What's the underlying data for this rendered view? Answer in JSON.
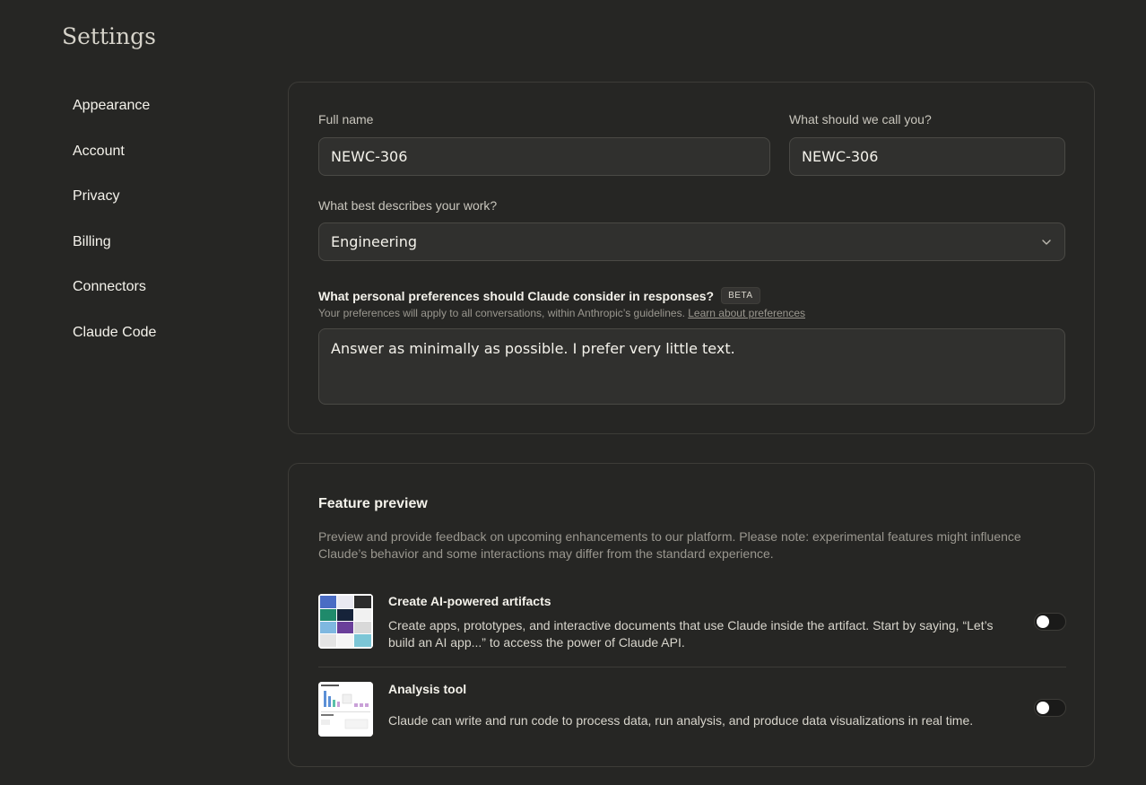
{
  "page": {
    "title": "Settings"
  },
  "sidebar": {
    "items": [
      {
        "label": "Appearance"
      },
      {
        "label": "Account"
      },
      {
        "label": "Privacy"
      },
      {
        "label": "Billing"
      },
      {
        "label": "Connectors"
      },
      {
        "label": "Claude Code"
      }
    ]
  },
  "profile": {
    "full_name_label": "Full name",
    "full_name_value": "NEWC-306",
    "nickname_label": "What should we call you?",
    "nickname_value": "NEWC-306",
    "work_label": "What best describes your work?",
    "work_value": "Engineering",
    "preferences_label": "What personal preferences should Claude consider in responses?",
    "beta_badge": "BETA",
    "preferences_hint": "Your preferences will apply to all conversations, within Anthropic’s guidelines.",
    "preferences_link": "Learn about preferences",
    "preferences_value": "Answer as minimally as possible. I prefer very little text."
  },
  "feature_preview": {
    "title": "Feature preview",
    "description": "Preview and provide feedback on upcoming enhancements to our platform. Please note: experimental features might influence Claude’s behavior and some interactions may differ from the standard experience.",
    "features": [
      {
        "title": "Create AI-powered artifacts",
        "description": "Create apps, prototypes, and interactive documents that use Claude inside the artifact. Start by saying, “Let’s build an AI app...” to access the power of Claude API.",
        "enabled": false
      },
      {
        "title": "Analysis tool",
        "description": "Claude can write and run code to process data, run analysis, and produce data visualizations in real time.",
        "enabled": false
      }
    ]
  },
  "colors": {
    "background": "#262624",
    "card_border": "#3d3c38",
    "input_bg": "#30302e",
    "text_primary": "#f4f2eb",
    "text_muted": "#9a978f"
  }
}
